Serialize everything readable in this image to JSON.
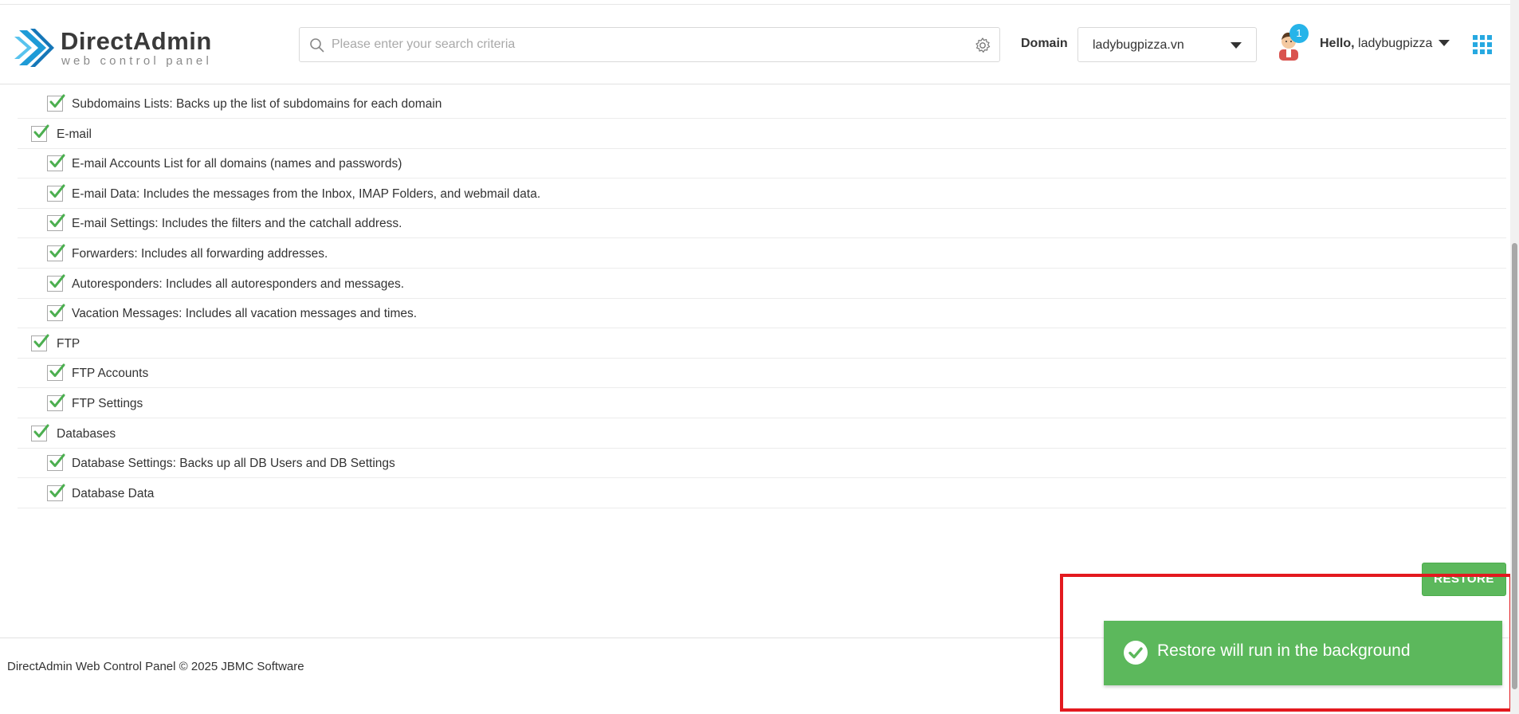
{
  "header": {
    "logo_title": "DirectAdmin",
    "logo_subtitle": "web control panel",
    "search_placeholder": "Please enter your search criteria",
    "domain_label": "Domain",
    "domain_value": "ladybugpizza.vn",
    "notification_count": "1",
    "hello_prefix": "Hello,",
    "username": "ladybugpizza"
  },
  "backup_items": [
    {
      "label": "Subdomains Lists: Backs up the list of subdomains for each domain",
      "level": "sub",
      "checked": true
    },
    {
      "label": "E-mail",
      "level": "top",
      "checked": true
    },
    {
      "label": "E-mail Accounts List for all domains (names and passwords)",
      "level": "sub",
      "checked": true
    },
    {
      "label": "E-mail Data: Includes the messages from the Inbox, IMAP Folders, and webmail data.",
      "level": "sub",
      "checked": true
    },
    {
      "label": "E-mail Settings: Includes the filters and the catchall address.",
      "level": "sub",
      "checked": true
    },
    {
      "label": "Forwarders: Includes all forwarding addresses.",
      "level": "sub",
      "checked": true
    },
    {
      "label": "Autoresponders: Includes all autoresponders and messages.",
      "level": "sub",
      "checked": true
    },
    {
      "label": "Vacation Messages: Includes all vacation messages and times.",
      "level": "sub",
      "checked": true
    },
    {
      "label": "FTP",
      "level": "top",
      "checked": true
    },
    {
      "label": "FTP Accounts",
      "level": "sub",
      "checked": true
    },
    {
      "label": "FTP Settings",
      "level": "sub",
      "checked": true
    },
    {
      "label": "Databases",
      "level": "top",
      "checked": true
    },
    {
      "label": "Database Settings: Backs up all DB Users and DB Settings",
      "level": "sub",
      "checked": true
    },
    {
      "label": "Database Data",
      "level": "sub",
      "checked": true
    }
  ],
  "restore_button": "RESTORE",
  "footer": "DirectAdmin Web Control Panel © 2025 JBMC Software",
  "toast": {
    "message": "Restore will run in the background"
  },
  "colors": {
    "accent_green": "#5cb85c",
    "check_green": "#4caf50",
    "badge_blue": "#27b4e9",
    "highlight_red": "#e3191f",
    "logo_blue": "#1e9bd7"
  }
}
